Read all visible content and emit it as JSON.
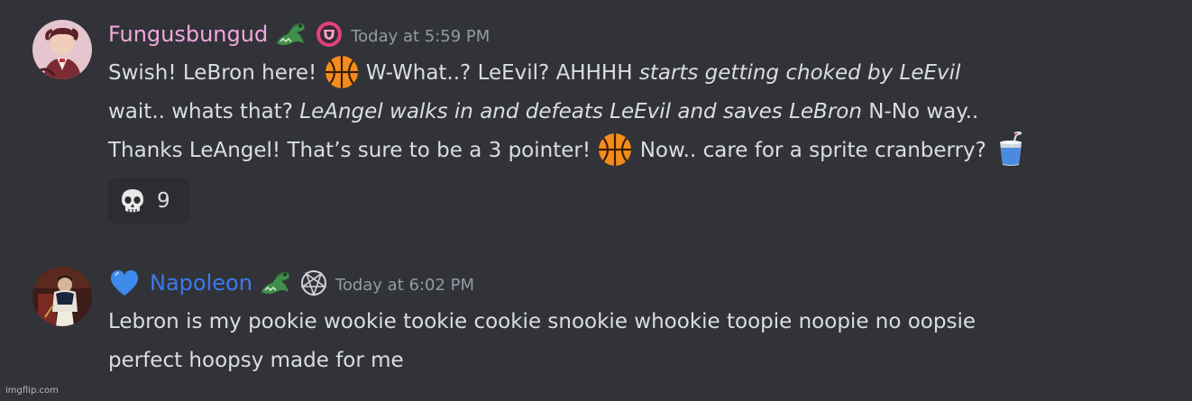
{
  "messages": [
    {
      "username": "Fungusbungud",
      "username_color": "#f2a7df",
      "avatar_icon": "red-haired-character-avatar",
      "badges": [
        "crocodile-icon",
        "pink-shield-icon"
      ],
      "timestamp": "Today at 5:59 PM",
      "text": {
        "l1a": "Swish! LeBron here! ",
        "l1b": " W-What..? LeEvil? AHHHH ",
        "l1c": "starts getting choked by LeEvil",
        "l2a": "wait.. whats that? ",
        "l2b": "LeAngel walks in and defeats LeEvil and saves LeBron",
        "l2c": " N-No way..",
        "l3a": "Thanks LeAngel! That’s sure to be a 3 pointer! ",
        "l3b": " Now.. care for a sprite cranberry? "
      },
      "inline_emojis": [
        "basketball-icon",
        "basketball-icon",
        "cranberry-drink-icon"
      ],
      "reaction": {
        "emoji": "skull-icon",
        "count": "9"
      }
    },
    {
      "username": "Napoleon",
      "username_color": "#3d78ee",
      "avatar_icon": "napoleon-portrait-avatar",
      "prefix_icon": "blue-heart-icon",
      "badges": [
        "crocodile-icon",
        "pentagram-icon"
      ],
      "timestamp": "Today at 6:02 PM",
      "text": {
        "l1": "Lebron is my pookie wookie tookie cookie snookie whookie toopie noopie no oopsie",
        "l2": "perfect hoopsy made for me"
      }
    }
  ],
  "watermark": "imgflip.com",
  "colors": {
    "background": "#313338",
    "text": "#dbdee1",
    "timestamp": "#949ba4",
    "reaction_bg": "#2b2d31"
  }
}
